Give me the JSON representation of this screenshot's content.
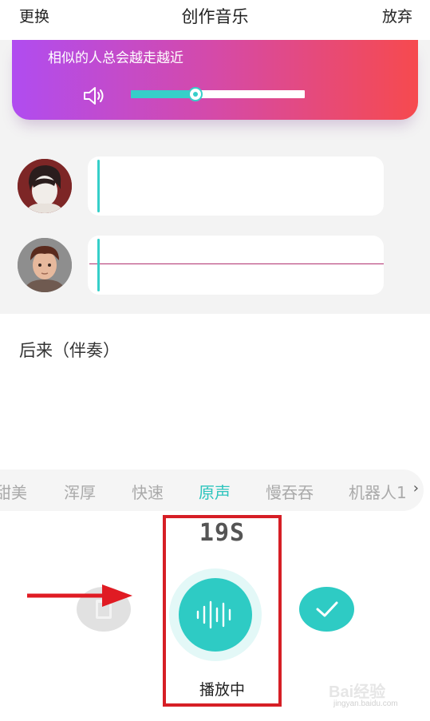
{
  "header": {
    "left_label": "更换",
    "title": "创作音乐",
    "right_label": "放弃"
  },
  "player_card": {
    "song_lyric": "相似的人总会越走越近",
    "volume_level": 0.37
  },
  "tracks": [
    {
      "name": "original-voice"
    },
    {
      "name": "recorded-voice"
    }
  ],
  "accompaniment": {
    "title": "后来（伴奏）"
  },
  "effects": {
    "items": [
      "甜美",
      "浑厚",
      "快速",
      "原声",
      "慢吞吞",
      "机器人1"
    ],
    "selected": "原声",
    "more_icon": "chevron-right-icon"
  },
  "recorder": {
    "timer": "19S",
    "status_label": "播放中"
  },
  "colors": {
    "accent": "#2ecbc4",
    "gradient_start": "#b04cf0",
    "gradient_end": "#f64a4e",
    "highlight_box": "#d61f26",
    "arrow": "#e01b23"
  },
  "watermark": {
    "brand": "Bai经验",
    "url": "jingyan.baidu.com"
  }
}
